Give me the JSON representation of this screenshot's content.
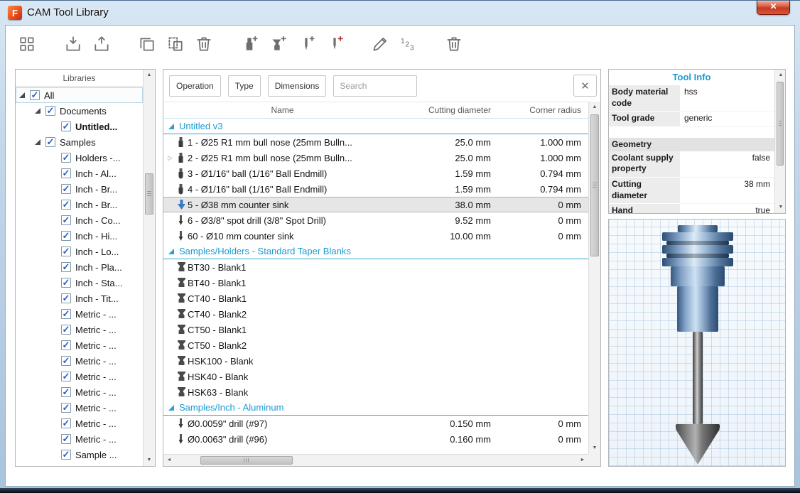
{
  "window": {
    "title": "CAM Tool Library",
    "icon_letter": "F"
  },
  "icons": {
    "close": "✕",
    "clear": "✕",
    "check": "✓",
    "scroll_up": "▲",
    "scroll_down": "▼",
    "scroll_left": "◄",
    "scroll_right": "►",
    "expander_collapsed": "▷"
  },
  "toolbar": {
    "buttons": [
      {
        "name": "new-library",
        "icon": "library"
      },
      {
        "name": "import-library",
        "icon": "import",
        "gap": true
      },
      {
        "name": "export-library",
        "icon": "export"
      },
      {
        "name": "copy-tool",
        "icon": "copy",
        "gap": true
      },
      {
        "name": "paste-tool",
        "icon": "paste"
      },
      {
        "name": "delete-library-item",
        "icon": "trash"
      },
      {
        "name": "add-mill-tool",
        "icon": "add-mill",
        "gap": true
      },
      {
        "name": "add-holder",
        "icon": "add-holder"
      },
      {
        "name": "add-turning-tool",
        "icon": "add-turning"
      },
      {
        "name": "add-drill-tool",
        "icon": "add-drill"
      },
      {
        "name": "edit-tool",
        "icon": "pencil",
        "gap": true
      },
      {
        "name": "renumber-tools",
        "icon": "renumber"
      },
      {
        "name": "delete-tool",
        "icon": "trash",
        "gap": true
      }
    ]
  },
  "libraries": {
    "header": "Libraries",
    "items": [
      {
        "label": "All",
        "level": 0,
        "expanded": true,
        "checked": true,
        "focus": true
      },
      {
        "label": "Documents",
        "level": 1,
        "expanded": true,
        "checked": true
      },
      {
        "label": "Untitled...",
        "level": 2,
        "checked": true,
        "bold": true
      },
      {
        "label": "Samples",
        "level": 1,
        "expanded": true,
        "checked": true
      },
      {
        "label": "Holders -...",
        "level": 2,
        "checked": true
      },
      {
        "label": "Inch - Al...",
        "level": 2,
        "checked": true
      },
      {
        "label": "Inch - Br...",
        "level": 2,
        "checked": true
      },
      {
        "label": "Inch - Br...",
        "level": 2,
        "checked": true
      },
      {
        "label": "Inch - Co...",
        "level": 2,
        "checked": true
      },
      {
        "label": "Inch - Hi...",
        "level": 2,
        "checked": true
      },
      {
        "label": "Inch - Lo...",
        "level": 2,
        "checked": true
      },
      {
        "label": "Inch - Pla...",
        "level": 2,
        "checked": true
      },
      {
        "label": "Inch - Sta...",
        "level": 2,
        "checked": true
      },
      {
        "label": "Inch - Tit...",
        "level": 2,
        "checked": true
      },
      {
        "label": "Metric - ...",
        "level": 2,
        "checked": true
      },
      {
        "label": "Metric - ...",
        "level": 2,
        "checked": true
      },
      {
        "label": "Metric - ...",
        "level": 2,
        "checked": true
      },
      {
        "label": "Metric - ...",
        "level": 2,
        "checked": true
      },
      {
        "label": "Metric - ...",
        "level": 2,
        "checked": true
      },
      {
        "label": "Metric - ...",
        "level": 2,
        "checked": true
      },
      {
        "label": "Metric - ...",
        "level": 2,
        "checked": true
      },
      {
        "label": "Metric - ...",
        "level": 2,
        "checked": true
      },
      {
        "label": "Metric - ...",
        "level": 2,
        "checked": true
      },
      {
        "label": "Sample ...",
        "level": 2,
        "checked": true
      }
    ]
  },
  "filters": {
    "operation": "Operation",
    "type": "Type",
    "dimensions": "Dimensions",
    "search_placeholder": "Search"
  },
  "table": {
    "columns": [
      "Name",
      "Cutting diameter",
      "Corner radius"
    ],
    "groups": [
      {
        "label": "Untitled v3",
        "rows": [
          {
            "icon": "endmill",
            "name": "1 - Ø25 R1 mm bull nose (25mm Bulln...",
            "cutting_diameter": "25.0 mm",
            "corner_radius": "1.000 mm"
          },
          {
            "icon": "endmill",
            "expander": true,
            "name": "2 - Ø25 R1 mm bull nose (25mm Bulln...",
            "cutting_diameter": "25.0 mm",
            "corner_radius": "1.000 mm"
          },
          {
            "icon": "ballmill",
            "name": "3 - Ø1/16\" ball (1/16\" Ball Endmill)",
            "cutting_diameter": "1.59 mm",
            "corner_radius": "0.794 mm"
          },
          {
            "icon": "ballmill",
            "name": "4 - Ø1/16\" ball (1/16\" Ball Endmill)",
            "cutting_diameter": "1.59 mm",
            "corner_radius": "0.794 mm"
          },
          {
            "icon": "countersink",
            "name": "5 - Ø38 mm counter sink",
            "cutting_diameter": "38.0 mm",
            "corner_radius": "0 mm",
            "selected": true
          },
          {
            "icon": "drill",
            "name": "6 - Ø3/8\" spot drill (3/8\" Spot Drill)",
            "cutting_diameter": "9.52 mm",
            "corner_radius": "0 mm"
          },
          {
            "icon": "drill",
            "name": "60 - Ø10 mm counter sink",
            "cutting_diameter": "10.00 mm",
            "corner_radius": "0 mm"
          }
        ]
      },
      {
        "label": "Samples/Holders - Standard Taper Blanks",
        "rows": [
          {
            "icon": "holder",
            "name": "BT30 - Blank1",
            "cutting_diameter": "",
            "corner_radius": ""
          },
          {
            "icon": "holder",
            "name": "BT40 - Blank1",
            "cutting_diameter": "",
            "corner_radius": ""
          },
          {
            "icon": "holder",
            "name": "CT40 - Blank1",
            "cutting_diameter": "",
            "corner_radius": ""
          },
          {
            "icon": "holder",
            "name": "CT40 - Blank2",
            "cutting_diameter": "",
            "corner_radius": ""
          },
          {
            "icon": "holder",
            "name": "CT50 - Blank1",
            "cutting_diameter": "",
            "corner_radius": ""
          },
          {
            "icon": "holder",
            "name": "CT50 - Blank2",
            "cutting_diameter": "",
            "corner_radius": ""
          },
          {
            "icon": "holder",
            "name": "HSK100 - Blank",
            "cutting_diameter": "",
            "corner_radius": ""
          },
          {
            "icon": "holder",
            "name": "HSK40 - Blank",
            "cutting_diameter": "",
            "corner_radius": ""
          },
          {
            "icon": "holder",
            "name": "HSK63 - Blank",
            "cutting_diameter": "",
            "corner_radius": ""
          }
        ]
      },
      {
        "label": "Samples/Inch - Aluminum",
        "rows": [
          {
            "icon": "drill",
            "name": "Ø0.0059\" drill (#97)",
            "cutting_diameter": "0.150 mm",
            "corner_radius": "0 mm"
          },
          {
            "icon": "drill",
            "name": "Ø0.0063\" drill (#96)",
            "cutting_diameter": "0.160 mm",
            "corner_radius": "0 mm"
          }
        ]
      }
    ]
  },
  "tool_info": {
    "title": "Tool Info",
    "rows": [
      {
        "label": "Body material code",
        "value": "hss",
        "align": "left"
      },
      {
        "label": "Tool grade",
        "value": "generic",
        "align": "left"
      },
      {
        "type": "spacer"
      },
      {
        "type": "section",
        "label": "Geometry"
      },
      {
        "label": "Coolant supply property",
        "value": "false",
        "align": "right"
      },
      {
        "label": "Cutting diameter",
        "value": "38 mm",
        "align": "right"
      },
      {
        "label": "Hand",
        "value": "true",
        "align": "right"
      }
    ]
  },
  "colors": {
    "accent": "#1b9ad3",
    "group_line": "#2ea3da",
    "selection": "#e6e6e6"
  }
}
